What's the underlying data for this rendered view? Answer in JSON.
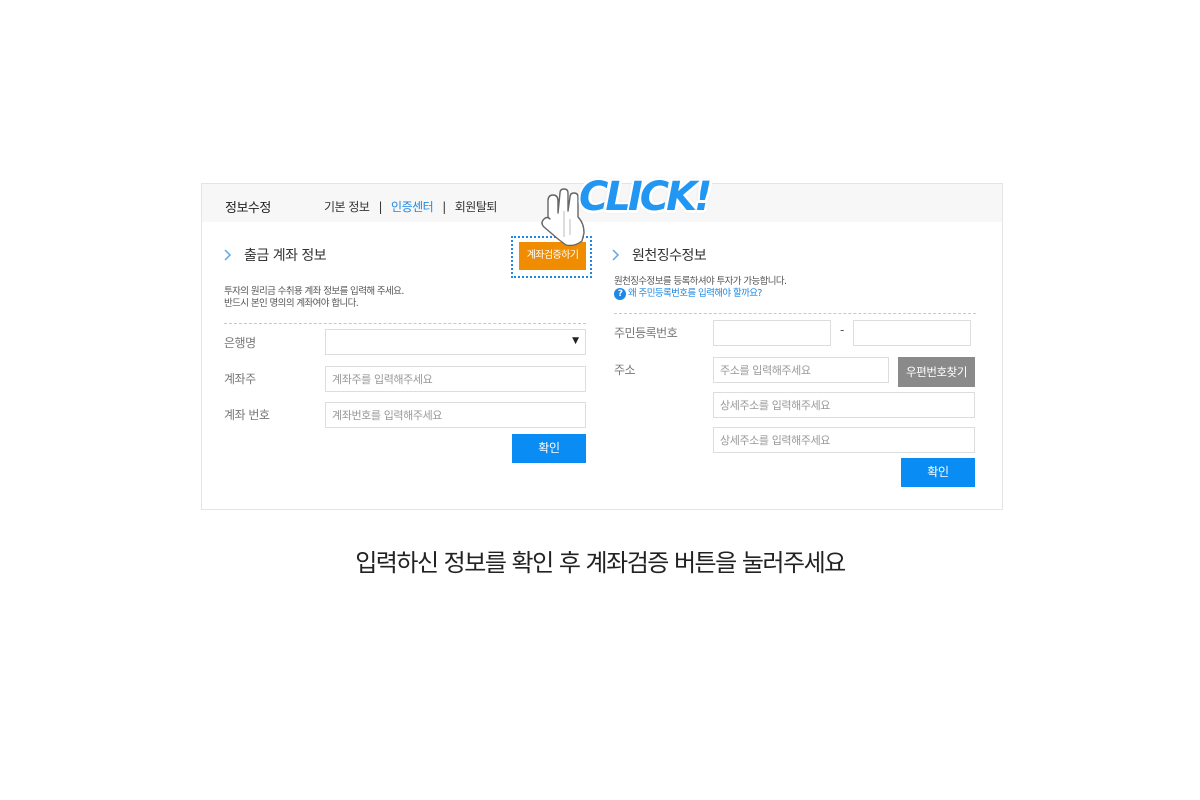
{
  "header": {
    "title": "정보수정",
    "tabs": [
      {
        "label": "기본 정보",
        "active": false
      },
      {
        "label": "인증센터",
        "active": true
      },
      {
        "label": "회원탈퇴",
        "active": false
      }
    ],
    "separator": "|"
  },
  "left": {
    "title": "출금 계좌 정보",
    "verify_button": "계좌검증하기",
    "desc_line1": "투자의 원리금 수취용 계좌 정보를 입력해 주세요.",
    "desc_line2": "반드시 본인 명의의 계좌여야 합니다.",
    "bank_label": "은행명",
    "bank_value": "",
    "holder_label": "계좌주",
    "holder_placeholder": "계좌주를 입력해주세요",
    "number_label": "계좌 번호",
    "number_placeholder": "계좌번호를 입력해주세요",
    "confirm_button": "확인"
  },
  "right": {
    "title": "원천징수정보",
    "desc_line1": "원천징수정보를 등록하셔야 투자가 가능합니다.",
    "help_icon": "?",
    "help_link": "왜 주민등록번호를 입력해야 할까요?",
    "rrn_label": "주민등록번호",
    "rrn_dash": "-",
    "address_label": "주소",
    "address_placeholder": "주소를 입력해주세요",
    "zip_button": "우편번호찾기",
    "detail_placeholder_1": "상세주소를 입력해주세요",
    "detail_placeholder_2": "상세주소를 입력해주세요",
    "confirm_button": "확인"
  },
  "overlay": {
    "click_text": "CLICK!",
    "hand_icon": "pointing-hand-icon"
  },
  "caption": "입력하신 정보를 확인 후 계좌검증 버튼을 눌러주세요",
  "colors": {
    "accent_blue": "#0a8cf5",
    "verify_orange": "#f08c00",
    "zip_gray": "#8a8a8a"
  }
}
